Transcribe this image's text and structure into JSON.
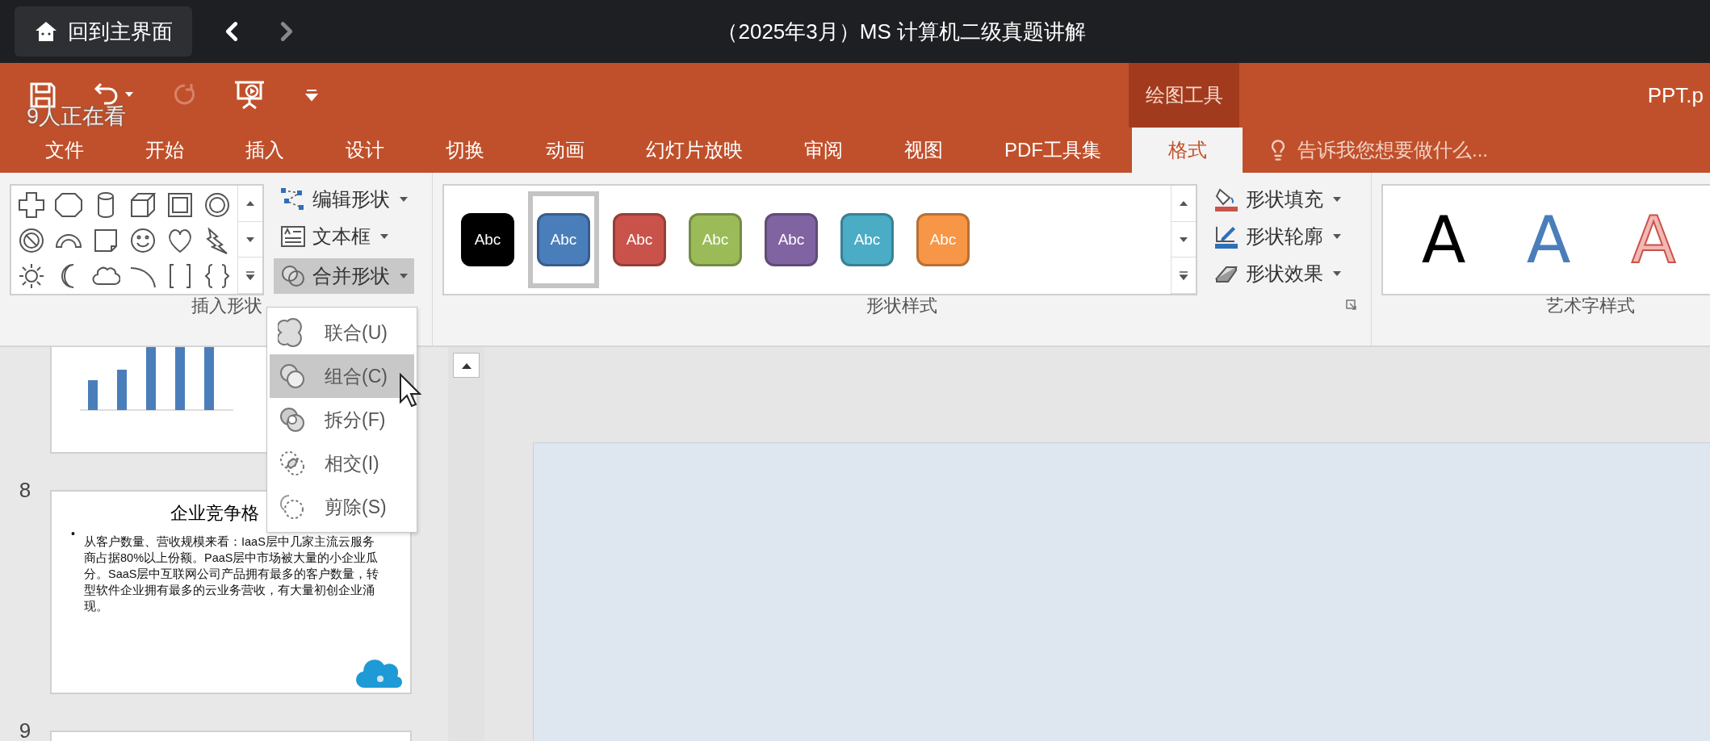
{
  "player": {
    "home": "回到主界面",
    "title": "（2025年3月）MS 计算机二级真题讲解"
  },
  "viewers": "9人正在看",
  "context_tab": "绘图工具",
  "file_name": "PPT.p",
  "tabs": [
    {
      "label": "文件",
      "selected": false
    },
    {
      "label": "开始",
      "selected": false
    },
    {
      "label": "插入",
      "selected": false
    },
    {
      "label": "设计",
      "selected": false
    },
    {
      "label": "切换",
      "selected": false
    },
    {
      "label": "动画",
      "selected": false
    },
    {
      "label": "幻灯片放映",
      "selected": false
    },
    {
      "label": "审阅",
      "selected": false
    },
    {
      "label": "视图",
      "selected": false
    },
    {
      "label": "PDF工具集",
      "selected": false
    },
    {
      "label": "格式",
      "selected": true
    }
  ],
  "tell_me": "告诉我您想要做什么...",
  "ribbon": {
    "insert_shapes": {
      "label": "插入形状",
      "buttons": [
        {
          "label": "编辑形状",
          "pressed": false
        },
        {
          "label": "文本框",
          "pressed": false
        },
        {
          "label": "合并形状",
          "pressed": true
        }
      ]
    },
    "shape_styles": {
      "label": "形状样式",
      "styles": [
        {
          "label": "Abc",
          "color": "#000000",
          "selected": false
        },
        {
          "label": "Abc",
          "color": "#4a7ebb",
          "selected": true
        },
        {
          "label": "Abc",
          "color": "#c9534a",
          "selected": false
        },
        {
          "label": "Abc",
          "color": "#9bbb59",
          "selected": false
        },
        {
          "label": "Abc",
          "color": "#8064a2",
          "selected": false
        },
        {
          "label": "Abc",
          "color": "#4bacc6",
          "selected": false
        },
        {
          "label": "Abc",
          "color": "#f79646",
          "selected": false
        }
      ],
      "commands": [
        "形状填充",
        "形状轮廓",
        "形状效果"
      ]
    },
    "wordart": {
      "label": "艺术字样式",
      "styles": [
        {
          "label": "A",
          "kind": "black"
        },
        {
          "label": "A",
          "kind": "blue"
        },
        {
          "label": "A",
          "kind": "outline"
        }
      ]
    }
  },
  "merge_menu": [
    {
      "label": "联合(U)",
      "selected": false
    },
    {
      "label": "组合(C)",
      "selected": true
    },
    {
      "label": "拆分(F)",
      "selected": false
    },
    {
      "label": "相交(I)",
      "selected": false
    },
    {
      "label": "剪除(S)",
      "selected": false
    }
  ],
  "slides": [
    {
      "kind": "chart"
    },
    {
      "kind": "text",
      "number": "8",
      "title": "企业竞争格",
      "bullet": "•",
      "body": "从客户数量、营收规模来看：IaaS层中几家主流云服务商占据80%以上份额。PaaS层中市场被大量的小企业瓜分。SaaS层中互联网公司产品拥有最多的客户数量，转型软件企业拥有最多的云业务营收，有大量初创企业涌现。"
    },
    {
      "kind": "blank",
      "number": "9"
    }
  ]
}
